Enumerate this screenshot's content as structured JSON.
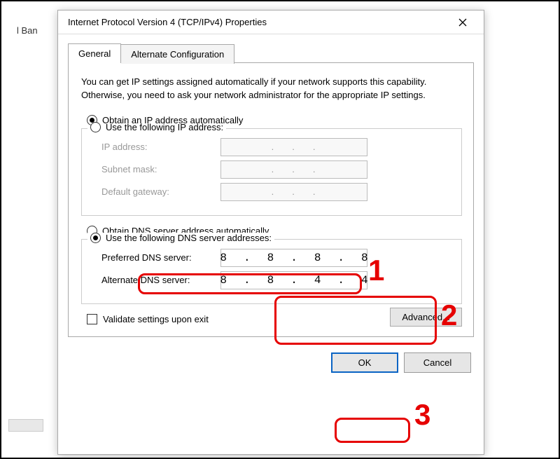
{
  "bg": {
    "partial_label": "l Ban"
  },
  "dialog": {
    "title": "Internet Protocol Version 4 (TCP/IPv4) Properties",
    "tabs": {
      "general": "General",
      "alternate": "Alternate Configuration"
    },
    "info": "You can get IP settings assigned automatically if your network supports this capability. Otherwise, you need to ask your network administrator for the appropriate IP settings.",
    "ip_section": {
      "radio_auto": "Obtain an IP address automatically",
      "radio_manual": "Use the following IP address:",
      "ip_label": "IP address:",
      "subnet_label": "Subnet mask:",
      "gateway_label": "Default gateway:"
    },
    "dns_section": {
      "radio_auto": "Obtain DNS server address automatically",
      "radio_manual": "Use the following DNS server addresses:",
      "preferred_label": "Preferred DNS server:",
      "alternate_label": "Alternate DNS server:",
      "preferred_value": [
        "8",
        "8",
        "8",
        "8"
      ],
      "alternate_value": [
        "8",
        "8",
        "4",
        "4"
      ]
    },
    "validate_label": "Validate settings upon exit",
    "advanced_label": "Advanced...",
    "ok_label": "OK",
    "cancel_label": "Cancel"
  },
  "annotations": {
    "1": "1",
    "2": "2",
    "3": "3"
  }
}
